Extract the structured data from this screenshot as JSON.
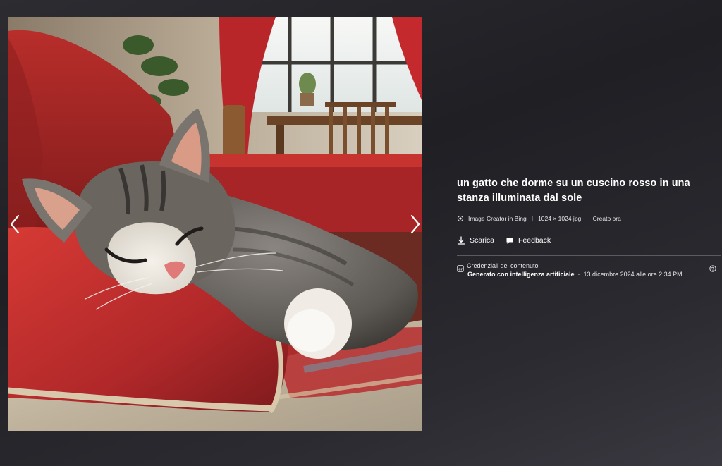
{
  "image": {
    "subject": "sleeping-cat-photo"
  },
  "navigation": {
    "prev_icon": "chevron-left-icon",
    "next_icon": "chevron-right-icon"
  },
  "details": {
    "title": "un gatto che dorme su un cuscino rosso in una stanza illuminata dal sole",
    "meta": {
      "creator": "Image Creator in Bing",
      "separator": "I",
      "dimensions": "1024 × 1024 jpg",
      "created": "Creato ora"
    },
    "actions": {
      "download_label": "Scarica",
      "feedback_label": "Feedback"
    },
    "credentials": {
      "heading": "Credenziali del contenuto",
      "generated_label": "Generato con intelligenza artificiale",
      "dot": "·",
      "date": "13 dicembre 2024 alle ore 2:34 PM"
    }
  },
  "colors": {
    "background": "#26262b",
    "text": "#ffffff",
    "divider": "#5a5a60"
  }
}
